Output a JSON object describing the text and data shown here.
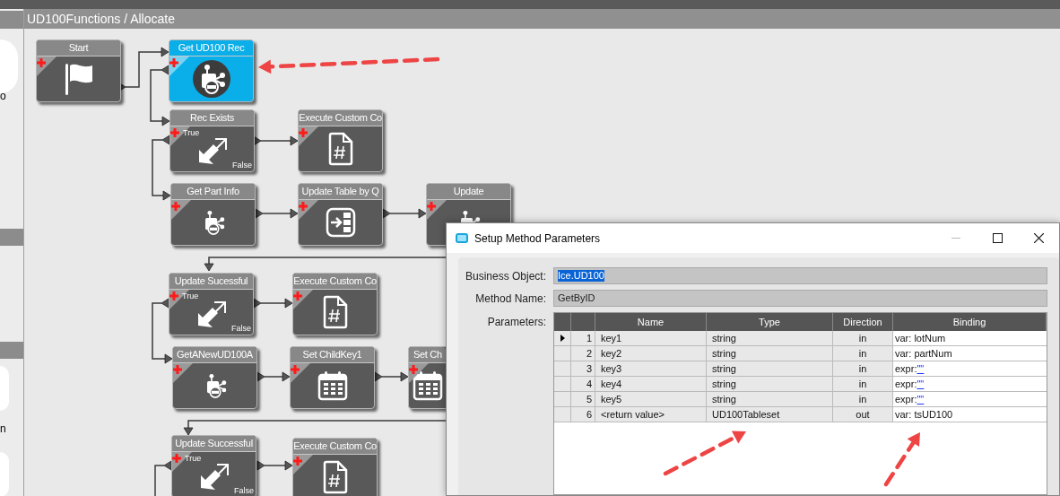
{
  "sidebar": {
    "labels": [
      "o",
      "n"
    ]
  },
  "canvas": {
    "breadcrumb": "UD100Functions / Allocate",
    "nodes": [
      {
        "title": "Start",
        "selected": false,
        "kind": "action"
      },
      {
        "title": "Get UD100 Rec",
        "selected": true,
        "kind": "action"
      },
      {
        "title": "Rec Exists",
        "selected": false,
        "kind": "condition",
        "true_label": "True",
        "false_label": "False"
      },
      {
        "title": "Execute Custom Co",
        "selected": false,
        "kind": "action"
      },
      {
        "title": "Get Part Info",
        "selected": false,
        "kind": "action"
      },
      {
        "title": "Update Table by Q",
        "selected": false,
        "kind": "action"
      },
      {
        "title": "Update",
        "selected": false,
        "kind": "action"
      },
      {
        "title": "Update Sucessful",
        "selected": false,
        "kind": "condition",
        "true_label": "True",
        "false_label": "False"
      },
      {
        "title": "Execute Custom Co",
        "selected": false,
        "kind": "action"
      },
      {
        "title": "GetANewUD100A",
        "selected": false,
        "kind": "action"
      },
      {
        "title": "Set ChildKey1",
        "selected": false,
        "kind": "action"
      },
      {
        "title": "Set Ch",
        "selected": false,
        "kind": "cut"
      },
      {
        "title": "Update Successful",
        "selected": false,
        "kind": "condition",
        "true_label": "True",
        "false_label": "False"
      },
      {
        "title": "Execute Custom Co",
        "selected": false,
        "kind": "action"
      }
    ]
  },
  "dialog": {
    "title": "Setup Method Parameters",
    "fields": [
      {
        "label": "Business Object:",
        "value": "Ice.UD100",
        "selected": true
      },
      {
        "label": "Method Name:",
        "value": "GetByID",
        "selected": false
      }
    ],
    "parameters_label": "Parameters:",
    "table": {
      "columns": [
        "Name",
        "Type",
        "Direction",
        "Binding"
      ],
      "rows": [
        {
          "num": "1",
          "name": "key1",
          "type": "string",
          "direction": "in",
          "binding": "var: lotNum",
          "selected": true
        },
        {
          "num": "2",
          "name": "key2",
          "type": "string",
          "direction": "in",
          "binding": "var: partNum",
          "selected": false
        },
        {
          "num": "3",
          "name": "key3",
          "type": "string",
          "direction": "in",
          "binding_prefix": "expr:",
          "binding_link": "\"\"",
          "selected": false
        },
        {
          "num": "4",
          "name": "key4",
          "type": "string",
          "direction": "in",
          "binding_prefix": "expr:",
          "binding_link": "\"\"",
          "selected": false
        },
        {
          "num": "5",
          "name": "key5",
          "type": "string",
          "direction": "in",
          "binding_prefix": "expr:",
          "binding_link": "\"\"",
          "selected": false
        },
        {
          "num": "6",
          "name": "<return value>",
          "type": "UD100Tableset",
          "direction": "out",
          "binding": "var: tsUD100",
          "selected": false
        }
      ]
    }
  }
}
